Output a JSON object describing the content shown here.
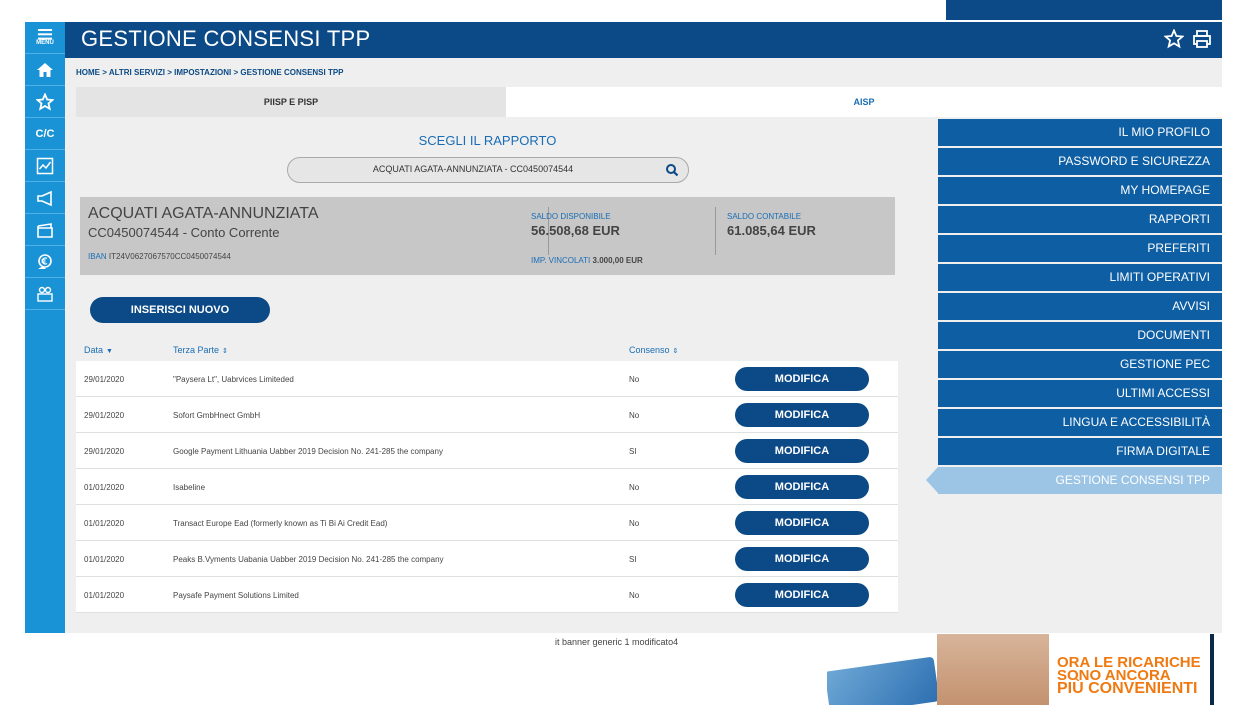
{
  "header": {
    "title": "GESTIONE CONSENSI TPP"
  },
  "rail": {
    "menu_label": "MENU",
    "cc_label": "C/C"
  },
  "breadcrumb": "HOME > ALTRI SERVIZI > IMPOSTAZIONI > GESTIONE CONSENSI TPP",
  "tabs": [
    {
      "label": "PIISP E PISP",
      "active": true
    },
    {
      "label": "AISP",
      "active": false
    }
  ],
  "selector": {
    "title": "SCEGLI IL RAPPORTO",
    "value": "ACQUATI AGATA-ANNUNZIATA - CC0450074544"
  },
  "account": {
    "name": "ACQUATI AGATA-ANNUNZIATA",
    "number": "CC0450074544 - Conto Corrente",
    "iban_label": "IBAN",
    "iban": "IT24V0627067570CC0450074544",
    "saldo_disponibile_label": "SALDO DISPONIBILE",
    "saldo_disponibile": "56.508,68 EUR",
    "saldo_contabile_label": "SALDO CONTABILE",
    "saldo_contabile": "61.085,64 EUR",
    "vincolati_label": "IMP. VINCOLATI",
    "vincolati": "3.000,00 EUR"
  },
  "new_button": "INSERISCI NUOVO",
  "table": {
    "headers": {
      "date": "Data",
      "party": "Terza Parte",
      "consent": "Consenso"
    },
    "action_label": "MODIFICA",
    "rows": [
      {
        "date": "29/01/2020",
        "party": "\"Paysera Lt\", Uabrvices Limiteded",
        "consent": "No"
      },
      {
        "date": "29/01/2020",
        "party": "Sofort GmbHnect GmbH",
        "consent": "No"
      },
      {
        "date": "29/01/2020",
        "party": "Google Payment Lithuania Uabber 2019 Decision No. 241-285 the company",
        "consent": "SI"
      },
      {
        "date": "01/01/2020",
        "party": "Isabeline",
        "consent": "No"
      },
      {
        "date": "01/01/2020",
        "party": "Transact Europe Ead (formerly known as Ti Bi Ai Credit Ead)",
        "consent": "No"
      },
      {
        "date": "01/01/2020",
        "party": "Peaks B.Vyments Uabania Uabber 2019 Decision No. 241-285 the company",
        "consent": "SI"
      },
      {
        "date": "01/01/2020",
        "party": "Paysafe Payment Solutions Limited",
        "consent": "No"
      }
    ]
  },
  "right_menu": [
    "IL MIO PROFILO",
    "PASSWORD E SICUREZZA",
    "MY HOMEPAGE",
    "RAPPORTI",
    "PREFERITI",
    "LIMITI OPERATIVI",
    "AVVISI",
    "DOCUMENTI",
    "GESTIONE PEC",
    "ULTIMI ACCESSI",
    "LINGUA E ACCESSIBILITÀ",
    "FIRMA DIGITALE",
    "GESTIONE CONSENSI TPP"
  ],
  "right_menu_active": "GESTIONE CONSENSI TPP",
  "banner": {
    "alt_text": "it banner generic 1 modificato4",
    "line1": "ORA LE RICARICHE",
    "line2": "SONO ANCORA",
    "line3": "PIÙ CONVENIENTI"
  },
  "colors": {
    "primary": "#0b4a86",
    "rail": "#1a93d6",
    "menu": "#0e5ea4",
    "active": "#9bc4e5"
  },
  "icons": [
    "menu-icon",
    "home-icon",
    "star-icon",
    "cc-icon",
    "chart-icon",
    "megaphone-icon",
    "folder-icon",
    "euro-icon",
    "people-icon",
    "print-icon",
    "search-icon"
  ]
}
